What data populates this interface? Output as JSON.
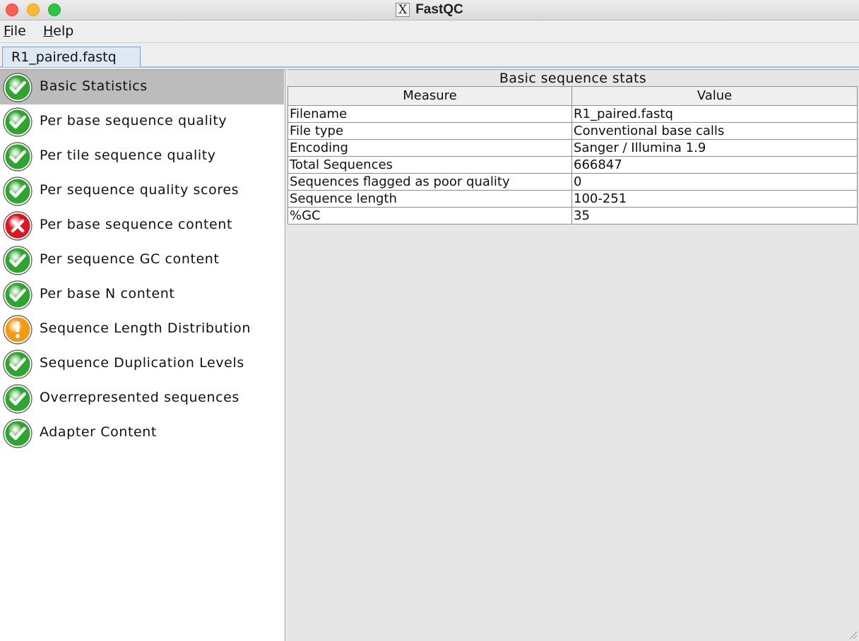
{
  "window": {
    "title": "FastQC",
    "app_glyph": "X"
  },
  "menu": {
    "file_mnemonic": "F",
    "file_rest": "ile",
    "help_mnemonic": "H",
    "help_rest": "elp"
  },
  "tab": {
    "label": "R1_paired.fastq"
  },
  "modules": [
    {
      "label": "Basic Statistics",
      "status": "pass",
      "icon": "check-circle-icon"
    },
    {
      "label": "Per base sequence quality",
      "status": "pass",
      "icon": "check-circle-icon"
    },
    {
      "label": "Per tile sequence quality",
      "status": "pass",
      "icon": "check-circle-icon"
    },
    {
      "label": "Per sequence quality scores",
      "status": "pass",
      "icon": "check-circle-icon"
    },
    {
      "label": "Per base sequence content",
      "status": "fail",
      "icon": "cross-circle-icon"
    },
    {
      "label": "Per sequence GC content",
      "status": "pass",
      "icon": "check-circle-icon"
    },
    {
      "label": "Per base N content",
      "status": "pass",
      "icon": "check-circle-icon"
    },
    {
      "label": "Sequence Length Distribution",
      "status": "warn",
      "icon": "warning-circle-icon"
    },
    {
      "label": "Sequence Duplication Levels",
      "status": "pass",
      "icon": "check-circle-icon"
    },
    {
      "label": "Overrepresented sequences",
      "status": "pass",
      "icon": "check-circle-icon"
    },
    {
      "label": "Adapter Content",
      "status": "pass",
      "icon": "check-circle-icon"
    }
  ],
  "stats": {
    "title": "Basic sequence stats",
    "columns": [
      "Measure",
      "Value"
    ],
    "rows": [
      [
        "Filename",
        "R1_paired.fastq"
      ],
      [
        "File type",
        "Conventional base calls"
      ],
      [
        "Encoding",
        "Sanger / Illumina 1.9"
      ],
      [
        "Total Sequences",
        "666847"
      ],
      [
        "Sequences flagged as poor quality",
        "0"
      ],
      [
        "Sequence length",
        "100-251"
      ],
      [
        "%GC",
        "35"
      ]
    ]
  },
  "colors": {
    "pass": "#2ea52e",
    "fail": "#e0141e",
    "warn": "#f39a12",
    "selected_row": "#bcbcbc"
  }
}
